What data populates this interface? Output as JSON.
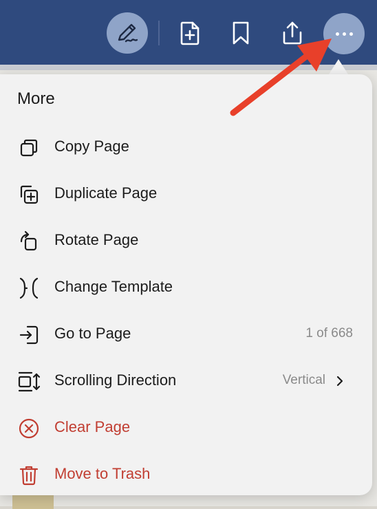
{
  "toolbar": {
    "icons": [
      "pen-icon",
      "new-page-icon",
      "bookmark-icon",
      "share-icon",
      "more-icon"
    ]
  },
  "popover": {
    "title": "More",
    "items": [
      {
        "label": "Copy Page",
        "icon": "copy-icon"
      },
      {
        "label": "Duplicate Page",
        "icon": "duplicate-icon"
      },
      {
        "label": "Rotate Page",
        "icon": "rotate-icon"
      },
      {
        "label": "Change Template",
        "icon": "template-icon"
      },
      {
        "label": "Go to Page",
        "icon": "go-to-page-icon",
        "value": "1 of 668"
      },
      {
        "label": "Scrolling Direction",
        "icon": "scroll-direction-icon",
        "value": "Vertical"
      },
      {
        "label": "Clear Page",
        "icon": "clear-icon"
      },
      {
        "label": "Move to Trash",
        "icon": "trash-icon"
      }
    ]
  },
  "colors": {
    "toolbar_bg": "#2f4a7e",
    "button_highlight": "#8fa4c8",
    "destructive": "#c13e32",
    "annotation_arrow": "#e8402a"
  }
}
